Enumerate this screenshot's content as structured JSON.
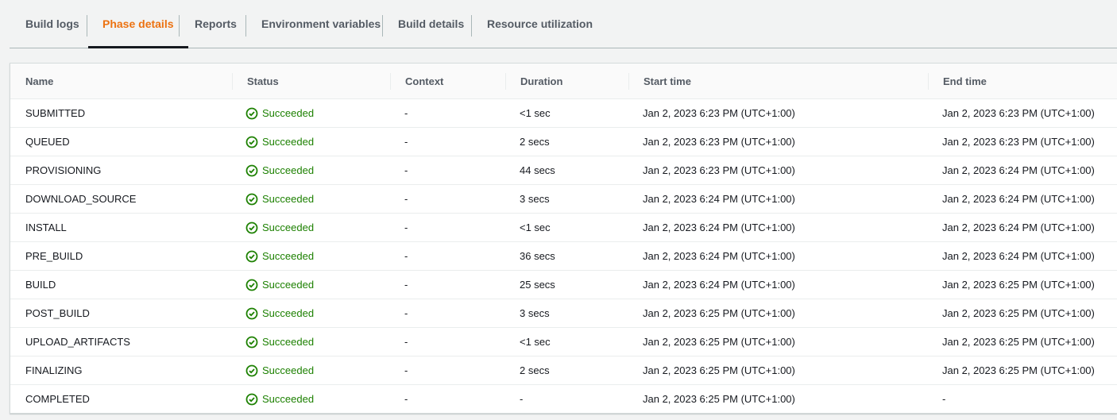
{
  "tabs": [
    {
      "label": "Build logs",
      "active": false
    },
    {
      "label": "Phase details",
      "active": true
    },
    {
      "label": "Reports",
      "active": false
    },
    {
      "label": "Environment variables",
      "active": false
    },
    {
      "label": "Build details",
      "active": false
    },
    {
      "label": "Resource utilization",
      "active": false
    }
  ],
  "table": {
    "columns": [
      "Name",
      "Status",
      "Context",
      "Duration",
      "Start time",
      "End time"
    ],
    "status_color": "#1d8102",
    "status_icon": "check-circle-icon",
    "rows": [
      {
        "name": "SUBMITTED",
        "status": "Succeeded",
        "context": "-",
        "duration": "<1 sec",
        "start": "Jan 2, 2023 6:23 PM (UTC+1:00)",
        "end": "Jan 2, 2023 6:23 PM (UTC+1:00)"
      },
      {
        "name": "QUEUED",
        "status": "Succeeded",
        "context": "-",
        "duration": "2 secs",
        "start": "Jan 2, 2023 6:23 PM (UTC+1:00)",
        "end": "Jan 2, 2023 6:23 PM (UTC+1:00)"
      },
      {
        "name": "PROVISIONING",
        "status": "Succeeded",
        "context": "-",
        "duration": "44 secs",
        "start": "Jan 2, 2023 6:23 PM (UTC+1:00)",
        "end": "Jan 2, 2023 6:24 PM (UTC+1:00)"
      },
      {
        "name": "DOWNLOAD_SOURCE",
        "status": "Succeeded",
        "context": "-",
        "duration": "3 secs",
        "start": "Jan 2, 2023 6:24 PM (UTC+1:00)",
        "end": "Jan 2, 2023 6:24 PM (UTC+1:00)"
      },
      {
        "name": "INSTALL",
        "status": "Succeeded",
        "context": "-",
        "duration": "<1 sec",
        "start": "Jan 2, 2023 6:24 PM (UTC+1:00)",
        "end": "Jan 2, 2023 6:24 PM (UTC+1:00)"
      },
      {
        "name": "PRE_BUILD",
        "status": "Succeeded",
        "context": "-",
        "duration": "36 secs",
        "start": "Jan 2, 2023 6:24 PM (UTC+1:00)",
        "end": "Jan 2, 2023 6:24 PM (UTC+1:00)"
      },
      {
        "name": "BUILD",
        "status": "Succeeded",
        "context": "-",
        "duration": "25 secs",
        "start": "Jan 2, 2023 6:24 PM (UTC+1:00)",
        "end": "Jan 2, 2023 6:25 PM (UTC+1:00)"
      },
      {
        "name": "POST_BUILD",
        "status": "Succeeded",
        "context": "-",
        "duration": "3 secs",
        "start": "Jan 2, 2023 6:25 PM (UTC+1:00)",
        "end": "Jan 2, 2023 6:25 PM (UTC+1:00)"
      },
      {
        "name": "UPLOAD_ARTIFACTS",
        "status": "Succeeded",
        "context": "-",
        "duration": "<1 sec",
        "start": "Jan 2, 2023 6:25 PM (UTC+1:00)",
        "end": "Jan 2, 2023 6:25 PM (UTC+1:00)"
      },
      {
        "name": "FINALIZING",
        "status": "Succeeded",
        "context": "-",
        "duration": "2 secs",
        "start": "Jan 2, 2023 6:25 PM (UTC+1:00)",
        "end": "Jan 2, 2023 6:25 PM (UTC+1:00)"
      },
      {
        "name": "COMPLETED",
        "status": "Succeeded",
        "context": "-",
        "duration": "-",
        "start": "Jan 2, 2023 6:25 PM (UTC+1:00)",
        "end": "-"
      }
    ]
  }
}
